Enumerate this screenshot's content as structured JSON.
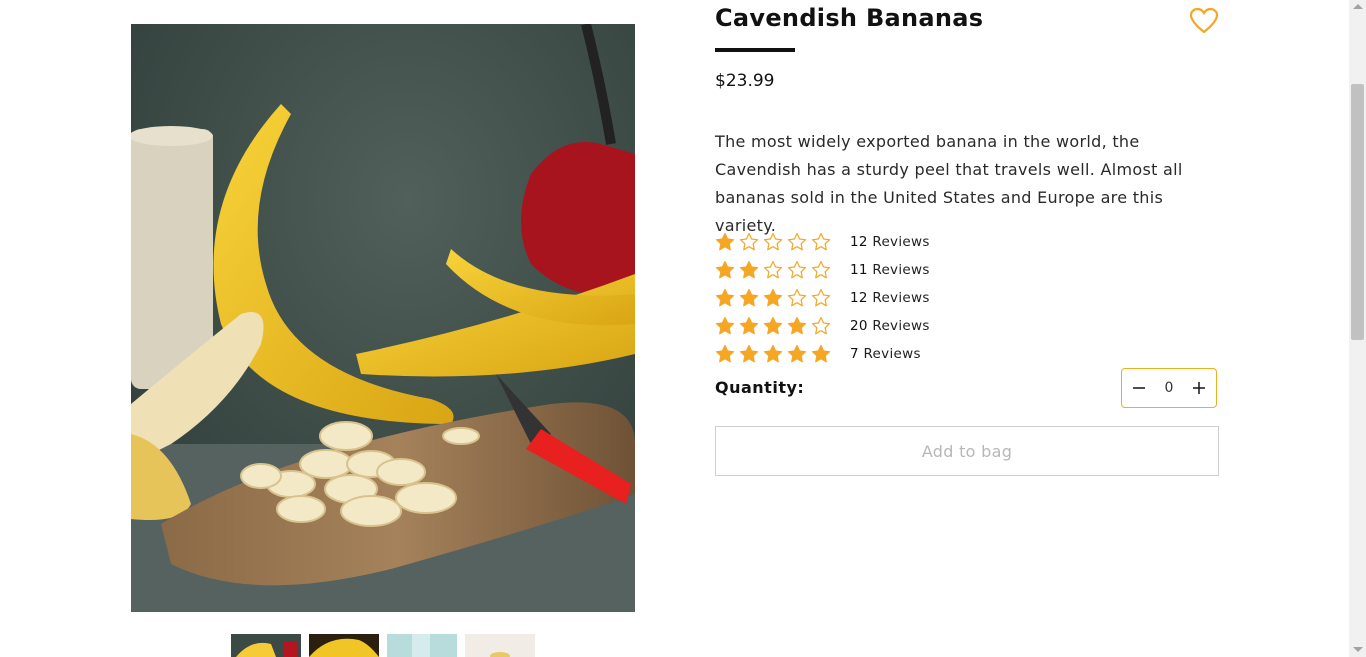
{
  "product": {
    "title": "Cavendish Bananas",
    "price": "$23.99",
    "description": "The most widely exported banana in the world, the Cavendish has a sturdy peel that travels well. Almost all bananas sold in the United States and Europe are this variety.",
    "image": "banana-photo",
    "thumbnails": [
      "banana-cutting-board-thumb",
      "banana-bunch-thumb",
      "banana-light-blue-thumb",
      "banana-white-thumb"
    ]
  },
  "ratings": [
    {
      "stars": 1,
      "count": "12",
      "label": "Reviews"
    },
    {
      "stars": 2,
      "count": "11",
      "label": "Reviews"
    },
    {
      "stars": 3,
      "count": "12",
      "label": "Reviews"
    },
    {
      "stars": 4,
      "count": "20",
      "label": "Reviews"
    },
    {
      "stars": 5,
      "count": "7",
      "label": "Reviews"
    }
  ],
  "quantity": {
    "label": "Quantity:",
    "value": "0",
    "decrease_icon": "minus-icon",
    "increase_icon": "plus-icon"
  },
  "add_to_bag": {
    "label": "Add to bag"
  },
  "wishlist": {
    "icon": "heart-icon"
  },
  "colors": {
    "accent": "#f5a623",
    "star": "#f5a623",
    "border": "#f0ad1e",
    "text": "#111111"
  }
}
